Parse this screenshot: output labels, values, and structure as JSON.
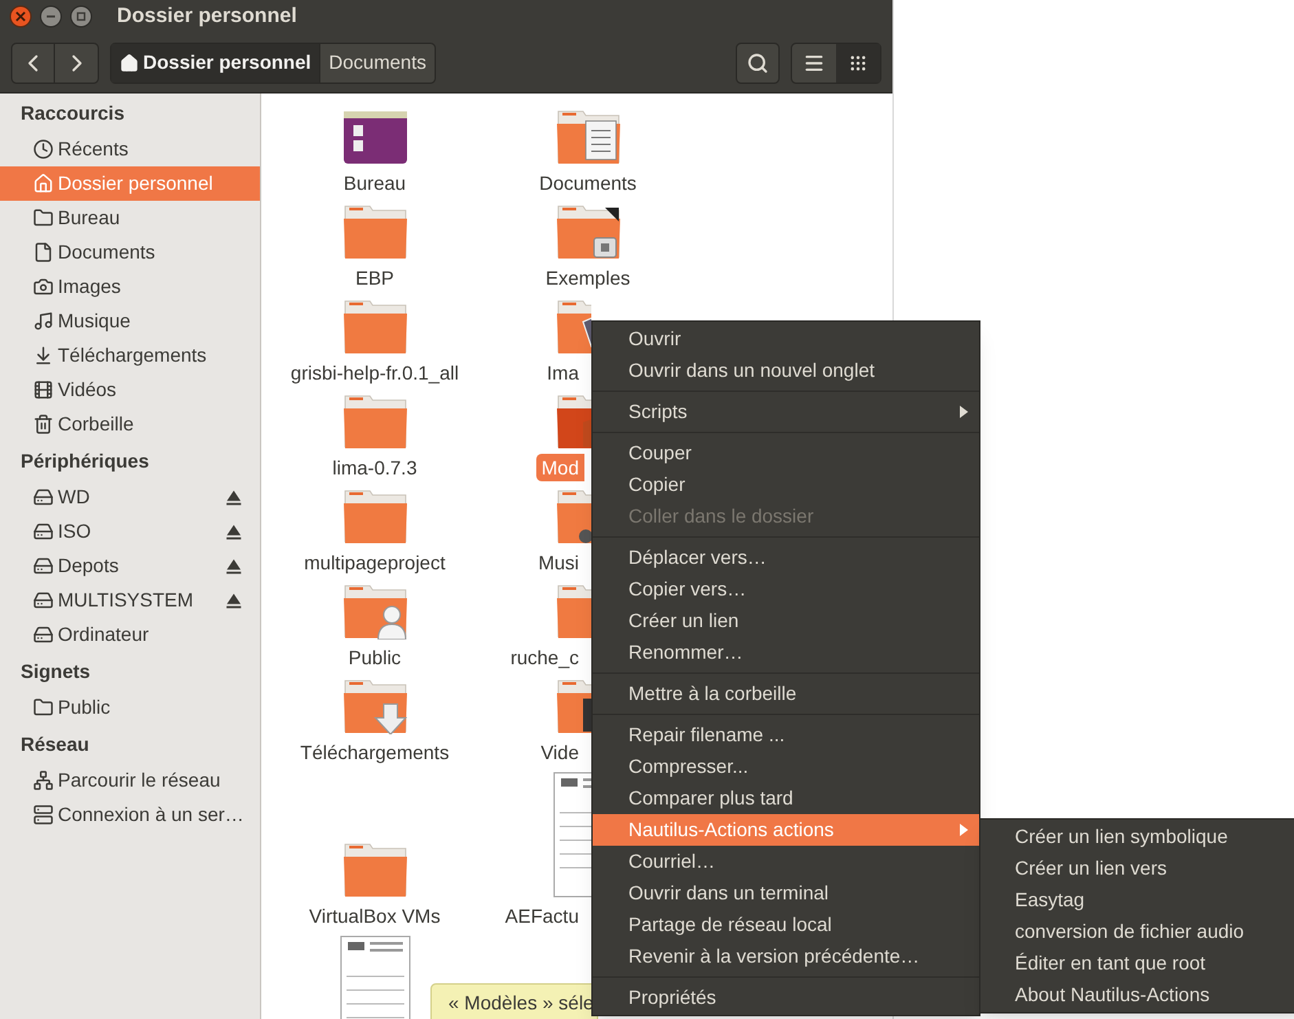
{
  "window": {
    "title": "Dossier personnel"
  },
  "toolbar": {
    "path": [
      {
        "label": "Dossier personnel",
        "kind": "home",
        "selected": true
      },
      {
        "label": "Documents",
        "kind": "folder",
        "selected": false
      }
    ],
    "views": [
      {
        "kind": "list",
        "selected": false
      },
      {
        "kind": "grid",
        "selected": true
      }
    ]
  },
  "sidebar": {
    "sections": [
      {
        "title": "Raccourcis",
        "items": [
          {
            "label": "Récents",
            "selected": false,
            "eject": false
          },
          {
            "label": "Dossier personnel",
            "selected": true,
            "eject": false
          },
          {
            "label": "Bureau",
            "selected": false,
            "eject": false
          },
          {
            "label": "Documents",
            "selected": false,
            "eject": false
          },
          {
            "label": "Images",
            "selected": false,
            "eject": false
          },
          {
            "label": "Musique",
            "selected": false,
            "eject": false
          },
          {
            "label": "Téléchargements",
            "selected": false,
            "eject": false
          },
          {
            "label": "Vidéos",
            "selected": false,
            "eject": false
          },
          {
            "label": "Corbeille",
            "selected": false,
            "eject": false
          }
        ]
      },
      {
        "title": "Périphériques",
        "items": [
          {
            "label": "WD",
            "selected": false,
            "eject": true
          },
          {
            "label": "ISO",
            "selected": false,
            "eject": true
          },
          {
            "label": "Depots",
            "selected": false,
            "eject": true
          },
          {
            "label": "MULTISYSTEM",
            "selected": false,
            "eject": true
          },
          {
            "label": "Ordinateur",
            "selected": false,
            "eject": false
          }
        ]
      },
      {
        "title": "Signets",
        "items": [
          {
            "label": "Public",
            "selected": false,
            "eject": false
          }
        ]
      },
      {
        "title": "Réseau",
        "items": [
          {
            "label": "Parcourir le réseau",
            "selected": false,
            "eject": false
          },
          {
            "label": "Connexion à un ser…",
            "selected": false,
            "eject": false
          }
        ]
      }
    ]
  },
  "files": [
    {
      "label": "Bureau",
      "kind": "desktop",
      "selected": false
    },
    {
      "label": "Documents",
      "kind": "folder",
      "selected": false
    },
    {
      "label": "EBP",
      "kind": "folder",
      "selected": false
    },
    {
      "label": "Exemples",
      "kind": "folder",
      "selected": false
    },
    {
      "label": "grisbi-help-fr.0.1_all",
      "kind": "folder",
      "selected": false
    },
    {
      "label": "Ima",
      "kind": "folder",
      "selected": false
    },
    {
      "label": "lima-0.7.3",
      "kind": "folder",
      "selected": false
    },
    {
      "label": "Mod",
      "kind": "folder",
      "selected": true
    },
    {
      "label": "multipageproject",
      "kind": "folder",
      "selected": false
    },
    {
      "label": "Musi",
      "kind": "folder",
      "selected": false
    },
    {
      "label": "Public",
      "kind": "folder",
      "selected": false
    },
    {
      "label": "ruche_c",
      "kind": "folder",
      "selected": false
    },
    {
      "label": "Téléchargements",
      "kind": "folder",
      "selected": false
    },
    {
      "label": "Vide",
      "kind": "folder",
      "selected": false
    },
    {
      "label": "VirtualBox VMs",
      "kind": "folder",
      "selected": false
    },
    {
      "label": "AEFactu",
      "kind": "document",
      "selected": false
    },
    {
      "kind": "document",
      "selected": false
    }
  ],
  "tooltip": "« Modèles » séle",
  "context_menu": {
    "sections": [
      [
        {
          "label": "Ouvrir",
          "disabled": false,
          "selected": false,
          "submenu": false
        },
        {
          "label": "Ouvrir dans un nouvel onglet",
          "disabled": false,
          "selected": false,
          "submenu": false
        }
      ],
      [
        {
          "label": "Scripts",
          "disabled": false,
          "selected": false,
          "submenu": true
        }
      ],
      [
        {
          "label": "Couper",
          "disabled": false,
          "selected": false,
          "submenu": false
        },
        {
          "label": "Copier",
          "disabled": false,
          "selected": false,
          "submenu": false
        },
        {
          "label": "Coller dans le dossier",
          "disabled": true,
          "selected": false,
          "submenu": false
        }
      ],
      [
        {
          "label": "Déplacer vers…",
          "disabled": false,
          "selected": false,
          "submenu": false
        },
        {
          "label": "Copier vers…",
          "disabled": false,
          "selected": false,
          "submenu": false
        },
        {
          "label": "Créer un lien",
          "disabled": false,
          "selected": false,
          "submenu": false
        },
        {
          "label": "Renommer…",
          "disabled": false,
          "selected": false,
          "submenu": false
        }
      ],
      [
        {
          "label": "Mettre à la corbeille",
          "disabled": false,
          "selected": false,
          "submenu": false
        }
      ],
      [
        {
          "label": "Repair filename ...",
          "disabled": false,
          "selected": false,
          "submenu": false
        },
        {
          "label": "Compresser...",
          "disabled": false,
          "selected": false,
          "submenu": false
        },
        {
          "label": "Comparer plus tard",
          "disabled": false,
          "selected": false,
          "submenu": false
        },
        {
          "label": "Nautilus-Actions actions",
          "disabled": false,
          "selected": true,
          "submenu": true
        },
        {
          "label": "Courriel…",
          "disabled": false,
          "selected": false,
          "submenu": false
        },
        {
          "label": "Ouvrir dans un terminal",
          "disabled": false,
          "selected": false,
          "submenu": false
        },
        {
          "label": "Partage de réseau local",
          "disabled": false,
          "selected": false,
          "submenu": false
        },
        {
          "label": "Revenir à la version précédente…",
          "disabled": false,
          "selected": false,
          "submenu": false
        }
      ],
      [
        {
          "label": "Propriétés",
          "disabled": false,
          "selected": false,
          "submenu": false
        }
      ]
    ]
  },
  "submenu": {
    "items": [
      {
        "label": "Créer un lien symbolique"
      },
      {
        "label": "Créer un lien vers"
      },
      {
        "label": "Easytag"
      },
      {
        "label": "conversion de fichier audio"
      },
      {
        "label": "Éditer en tant que root"
      },
      {
        "label": "About Nautilus-Actions"
      }
    ]
  }
}
